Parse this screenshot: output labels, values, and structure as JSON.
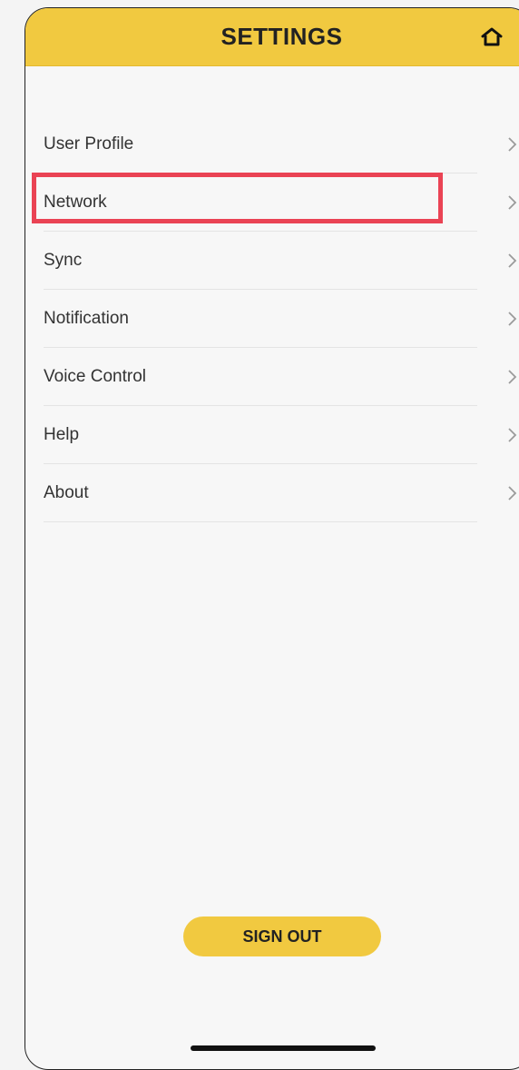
{
  "header": {
    "title": "SETTINGS",
    "home_icon": "home-icon",
    "background_color": "#f1c940"
  },
  "menu": {
    "items": [
      {
        "label": "User Profile",
        "icon": "chevron-right-icon"
      },
      {
        "label": "Network",
        "icon": "chevron-right-icon",
        "highlighted": true
      },
      {
        "label": "Sync",
        "icon": "chevron-right-icon"
      },
      {
        "label": "Notification",
        "icon": "chevron-right-icon"
      },
      {
        "label": "Voice Control",
        "icon": "chevron-right-icon"
      },
      {
        "label": "Help",
        "icon": "chevron-right-icon"
      },
      {
        "label": "About",
        "icon": "chevron-right-icon"
      }
    ],
    "highlight_color": "#ea4354"
  },
  "footer": {
    "sign_out_label": "SIGN OUT",
    "button_color": "#f1c940"
  }
}
